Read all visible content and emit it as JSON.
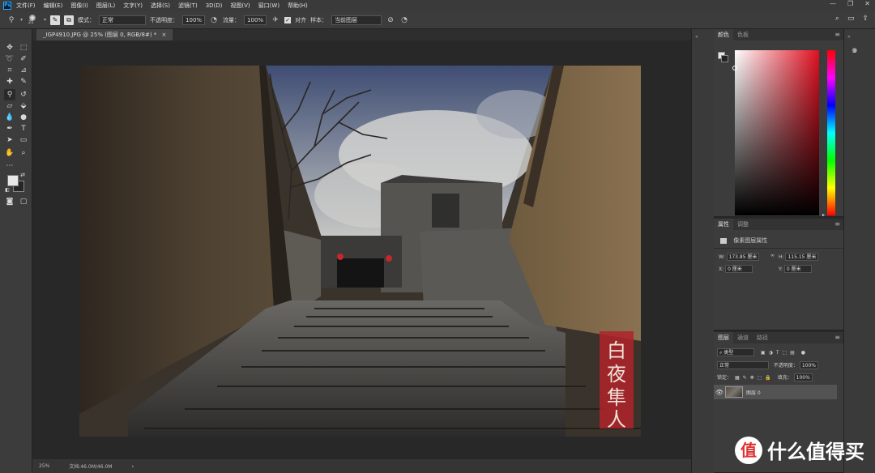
{
  "app": {
    "logo": "Ps"
  },
  "menu": [
    "文件(F)",
    "编辑(E)",
    "图像(I)",
    "图层(L)",
    "文字(Y)",
    "选择(S)",
    "滤镜(T)",
    "3D(D)",
    "视图(V)",
    "窗口(W)",
    "帮助(H)"
  ],
  "window_controls": {
    "minimize": "—",
    "restore": "❐",
    "close": "✕"
  },
  "options_bar": {
    "brush_size": "21",
    "mode_label": "模式：",
    "mode_value": "正常",
    "opacity_label": "不透明度：",
    "opacity_value": "100%",
    "flow_label": "流量：",
    "flow_value": "100%",
    "aligned_label": "对齐",
    "sample_label": "样本：",
    "sample_value": "当前图层"
  },
  "document_tab": {
    "title": "_IGP4910.JPG @ 25% (图层 0, RGB/8#) *",
    "close": "×"
  },
  "status_bar": {
    "zoom": "25%",
    "doc_size": "文档:46.0M/46.0M"
  },
  "color_panel": {
    "tabs": [
      "颜色",
      "色板"
    ],
    "active": 0,
    "accent_color": "#e01020"
  },
  "properties_panel": {
    "tabs": [
      "属性",
      "调整"
    ],
    "active": 0,
    "header": "像素图层属性",
    "w_label": "W:",
    "w_value": "173.85 厘米",
    "link_icon": "∞",
    "h_label": "H:",
    "h_value": "115.15 厘米",
    "x_label": "X:",
    "x_value": "0 厘米",
    "y_label": "Y:",
    "y_value": "0 厘米"
  },
  "layers_panel": {
    "tabs": [
      "图层",
      "通道",
      "路径"
    ],
    "active": 0,
    "filter_kind": "类型",
    "blend_mode": "正常",
    "opacity_label": "不透明度：",
    "opacity_value": "100%",
    "lock_label": "锁定：",
    "fill_label": "填充：",
    "fill_value": "100%",
    "layer_name": "图层 0"
  },
  "photo": {
    "watermark_chars": [
      "白",
      "夜",
      "隼",
      "人"
    ],
    "watermark_color": "#b0232a"
  },
  "site_watermark": {
    "brand": "什么值得买",
    "logo_char": "值"
  }
}
